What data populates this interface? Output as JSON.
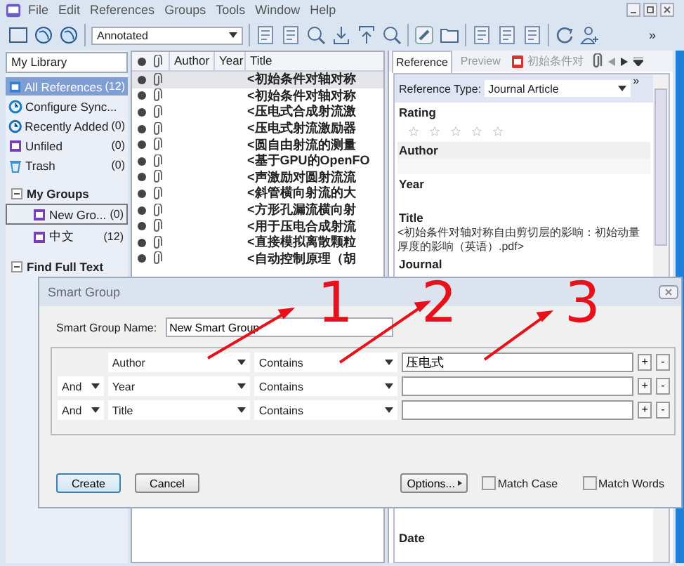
{
  "menu": [
    "File",
    "Edit",
    "References",
    "Groups",
    "Tools",
    "Window",
    "Help"
  ],
  "toolbar": {
    "style_dropdown": "Annotated",
    "overflow": "»"
  },
  "sidebar": {
    "header": "My Library",
    "items": [
      {
        "label": "All References",
        "count": "(12)",
        "kind": "all",
        "selected": true
      },
      {
        "label": "Configure Sync...",
        "kind": "sync",
        "selected": false
      },
      {
        "label": "Recently Added",
        "count": "(0)",
        "kind": "recent",
        "selected": false
      },
      {
        "label": "Unfiled",
        "count": "(0)",
        "kind": "unfiled",
        "selected": false
      },
      {
        "label": "Trash",
        "count": "(0)",
        "kind": "trash",
        "selected": false
      }
    ],
    "sections": [
      {
        "title": "My Groups",
        "expanded": true,
        "items": [
          {
            "label": "New Gro...",
            "count": "(0)",
            "focused": true
          },
          {
            "label": "中文",
            "count": "(12)",
            "focused": false
          }
        ]
      },
      {
        "title": "Find Full Text",
        "expanded": true
      }
    ]
  },
  "list": {
    "columns": [
      "Author",
      "Year",
      "Title"
    ],
    "rows": [
      {
        "title": "<初始条件对轴对称",
        "selected": true
      },
      {
        "title": "<初始条件对轴对称",
        "selected": false
      },
      {
        "title": "<压电式合成射流激",
        "selected": false
      },
      {
        "title": "<压电式射流激励器",
        "selected": false
      },
      {
        "title": "<圆自由射流的测量",
        "selected": false
      },
      {
        "title": "<基于GPU的OpenFO",
        "selected": false
      },
      {
        "title": "<声激励对圆射流流",
        "selected": false
      },
      {
        "title": "<斜管横向射流的大",
        "selected": false
      },
      {
        "title": "<方形孔漏流横向射",
        "selected": false
      },
      {
        "title": "<用于压电合成射流",
        "selected": false
      },
      {
        "title": "<直接模拟离散颗粒",
        "selected": false
      },
      {
        "title": "<自动控制原理（胡",
        "selected": false
      }
    ]
  },
  "reference": {
    "tabs": [
      {
        "label": "Reference",
        "kind": "text",
        "selected": true
      },
      {
        "label": "Preview",
        "kind": "text",
        "selected": false
      },
      {
        "label": "初始条件对",
        "kind": "pdf",
        "selected": false
      }
    ],
    "overflow": "»",
    "type_label": "Reference Type:",
    "type_value": "Journal Article",
    "fields": [
      {
        "label": "Rating",
        "kind": "rating",
        "stars": 0
      },
      {
        "label": "Author",
        "kind": "text",
        "shaded": true
      },
      {
        "label": "Year",
        "kind": "text",
        "shaded": false
      },
      {
        "label": "Title",
        "kind": "text",
        "shaded": false,
        "value": "<初始条件对轴对称自由剪切层的影响：初始动量厚度的影响（英语）.pdf>"
      },
      {
        "label": "Journal",
        "kind": "text",
        "shaded": false
      }
    ],
    "lower_fields": [
      {
        "label": "Date"
      }
    ]
  },
  "dialog": {
    "title": "Smart Group",
    "name_label": "Smart Group Name:",
    "name_value": "New Smart Group",
    "criteria": [
      {
        "field": "Author",
        "operator": "Contains",
        "value": "压电式",
        "add": "+",
        "remove": "-"
      },
      {
        "conjunction": "And",
        "field": "Year",
        "operator": "Contains",
        "add": "+",
        "remove": "-"
      },
      {
        "conjunction": "And",
        "field": "Title",
        "operator": "Contains",
        "add": "+",
        "remove": "-"
      }
    ],
    "buttons": [
      {
        "label": "Create",
        "kind": "default"
      },
      {
        "label": "Cancel",
        "kind": "normal"
      }
    ],
    "options": "Options...",
    "checkboxes": [
      {
        "label": "Match Case",
        "checked": false
      },
      {
        "label": "Match Words",
        "checked": false
      }
    ]
  },
  "annotations": [
    {
      "label": "1"
    },
    {
      "label": "2"
    },
    {
      "label": "3"
    }
  ]
}
